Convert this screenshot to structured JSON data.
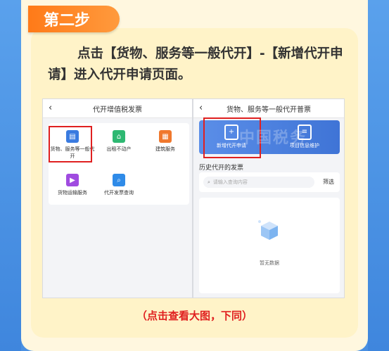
{
  "step": {
    "label": "第二步"
  },
  "instruction": {
    "text": "点击【货物、服务等一般代开】-【新增代开申请】进入代开申请页面。"
  },
  "note": {
    "text": "（点击查看大图，下同）"
  },
  "left_screen": {
    "title": "代开增值税发票",
    "services": [
      {
        "label": "货物、服务等一般代开",
        "icon": "document-icon",
        "color": "#3a7be0"
      },
      {
        "label": "出租不动产",
        "icon": "house-icon",
        "color": "#2eb872"
      },
      {
        "label": "建筑服务",
        "icon": "building-icon",
        "color": "#f0782d"
      },
      {
        "label": "货物运输服务",
        "icon": "truck-icon",
        "color": "#a04be0"
      },
      {
        "label": "代开发票查询",
        "icon": "search-doc-icon",
        "color": "#2f8be8"
      }
    ]
  },
  "right_screen": {
    "title": "货物、服务等一般代开普票",
    "banner": [
      {
        "label": "新增代开申请",
        "icon": "add-doc-icon"
      },
      {
        "label": "项目信息维护",
        "icon": "list-doc-icon"
      }
    ],
    "history_title": "历史代开的发票",
    "search_placeholder": "请输入查询内容",
    "filter_label": "筛选",
    "empty_text": "暂无数据",
    "watermark": "中国税务"
  },
  "colors": {
    "accent": "#ff7a18",
    "highlight": "#e02020",
    "banner": "#4a80e0"
  }
}
